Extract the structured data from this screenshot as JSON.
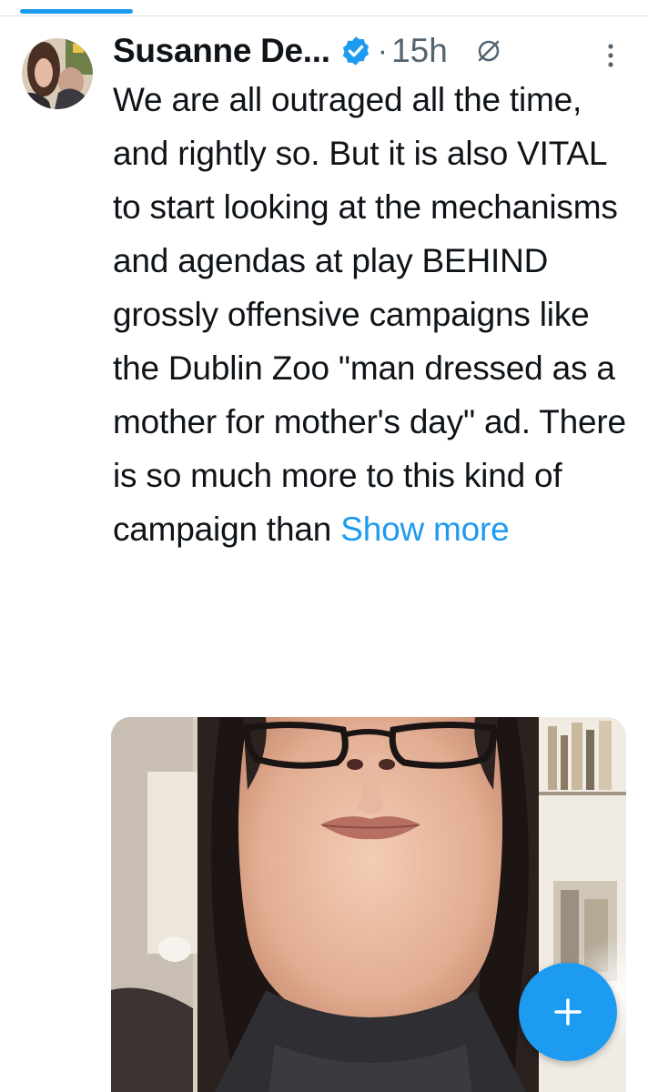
{
  "tweet": {
    "author_name": "Susanne De...",
    "separator": "·",
    "timestamp": "15h",
    "text": "We are all outraged all the time, and rightly so. But it is also VITAL to start looking at the mechanisms and agendas at play BEHIND grossly offensive campaigns like the Dublin Zoo \"man dressed as a mother for mother's day\" ad. There is so much more to this kind of campaign than",
    "show_more_label": "Show more",
    "icons": {
      "verified": "verified-badge-icon",
      "grok": "circle-slash-icon",
      "more": "more-vertical-icon"
    }
  },
  "compose_button": {
    "icon": "plus-icon"
  },
  "colors": {
    "accent": "#1d9bf0",
    "text_primary": "#0f1419",
    "text_secondary": "#536471",
    "background": "#ffffff"
  }
}
